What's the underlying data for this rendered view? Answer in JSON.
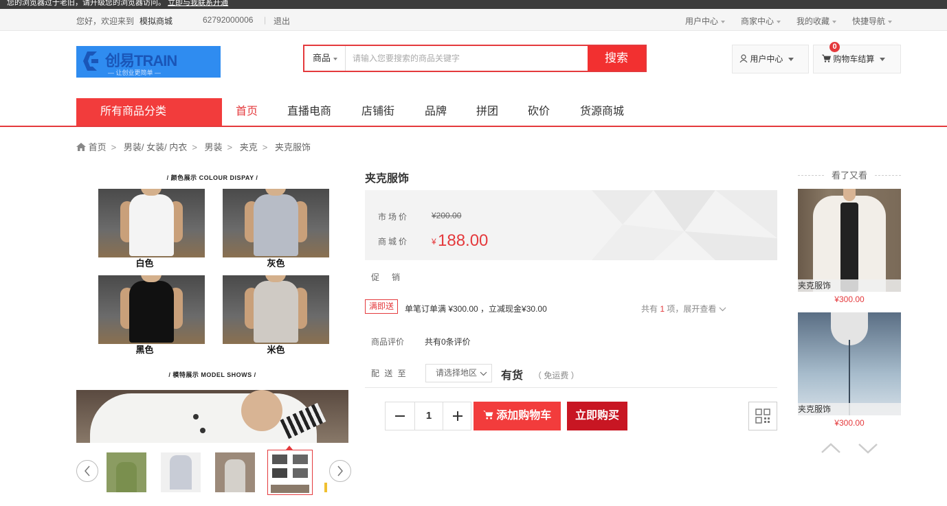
{
  "notice": {
    "text": "您的浏览器过于老旧，请升级您的浏览器访问。",
    "link": "立即与我联系开通"
  },
  "topbar": {
    "greeting": "您好，欢迎来到",
    "shop_name": "模拟商城",
    "phone": "62792000006",
    "logout": "退出",
    "menus": [
      "用户中心",
      "商家中心",
      "我的收藏",
      "快捷导航"
    ]
  },
  "logo": {
    "text": "创易TRAIN",
    "slogan": "— 让创业更简单 —"
  },
  "search": {
    "category": "商品",
    "placeholder": "请输入您要搜索的商品关键字",
    "button": "搜索"
  },
  "header": {
    "user_center": "用户中心",
    "cart": "购物车结算",
    "cart_count": "0"
  },
  "nav": {
    "all": "所有商品分类",
    "items": [
      "首页",
      "直播电商",
      "店铺街",
      "品牌",
      "拼团",
      "砍价",
      "货源商城"
    ]
  },
  "breadcrumb": [
    "首页",
    "男装/ 女装/ 内衣",
    "男装",
    "夹克",
    "夹克服饰"
  ],
  "gallery": {
    "color_heading": "/   颜色展示 COLOUR DISPAY   /",
    "model_heading": "/   模特展示 MODEL SHOWS   /",
    "colors": [
      "白色",
      "灰色",
      "黑色",
      "米色"
    ]
  },
  "product": {
    "title": "夹克服饰",
    "market_label": "市场价",
    "market_price": "¥200.00",
    "shop_label": "商城价",
    "currency": "¥",
    "price": "188.00",
    "promo_label": "促　销",
    "promo_tag": "满即送",
    "promo_text": "单笔订单满 ¥300.00 ，立减现金¥30.00",
    "promo_more_prefix": "共有",
    "promo_more_count": "1",
    "promo_more_suffix": "项，展开查看",
    "review_label": "商品评价",
    "review_text": "共有0条评价",
    "ship_label": "配 送 至",
    "region": "请选择地区",
    "stock": "有货",
    "shipping": "（ 免运费 ）",
    "quantity": "1",
    "add_cart": "添加购物车",
    "buy_now": "立即购买"
  },
  "sidebar": {
    "title": "看了又看",
    "items": [
      {
        "name": "夹克服饰",
        "price": "¥300.00"
      },
      {
        "name": "夹克服饰",
        "price": "¥300.00"
      }
    ]
  },
  "colors": {
    "accent": "#e4393c",
    "logo_bg": "#2f8cf0",
    "buy": "#c81623"
  }
}
